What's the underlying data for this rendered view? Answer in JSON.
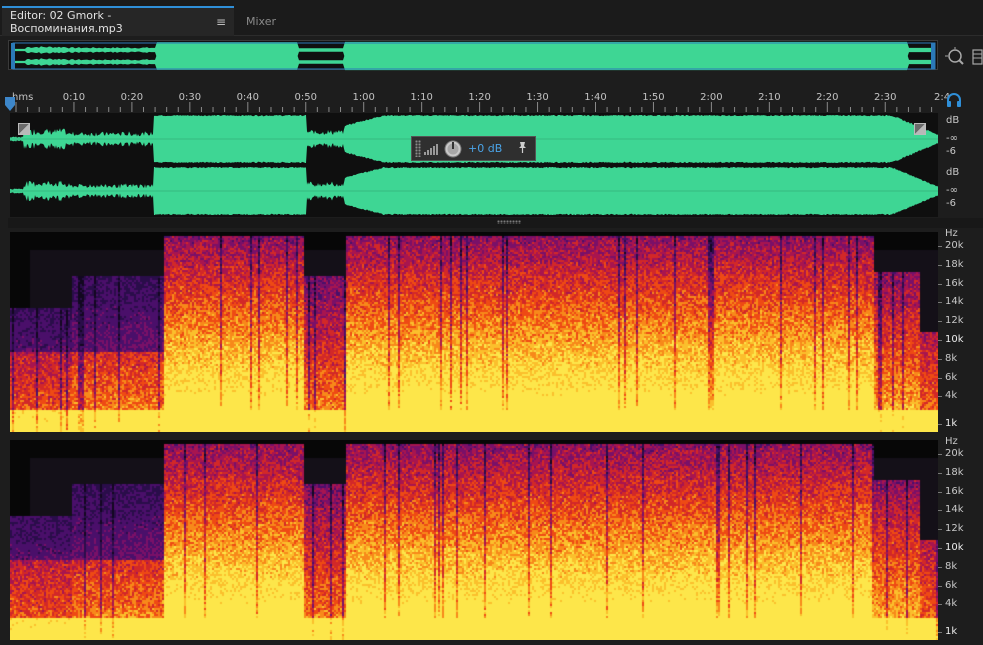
{
  "tabs": {
    "editor": {
      "label": "Editor: 02 Gmork - Воспоминания.mp3",
      "menu_glyph": "≡"
    },
    "mixer": {
      "label": "Mixer"
    }
  },
  "ruler": {
    "unit": "hms",
    "labels": [
      "0:10",
      "0:20",
      "0:30",
      "0:40",
      "0:50",
      "1:00",
      "1:10",
      "1:20",
      "1:30",
      "1:40",
      "1:50",
      "2:00",
      "2:10",
      "2:20",
      "2:30",
      "2:4"
    ]
  },
  "hud": {
    "value": "+0 dB",
    "pin_glyph": "✎"
  },
  "amplitude_scale": {
    "channel_1": [
      "dB",
      "-∞",
      "-6"
    ],
    "channel_2": [
      "dB",
      "-∞",
      "-6"
    ]
  },
  "frequency_scale": {
    "unit": "Hz",
    "labels": [
      "20k",
      "18k",
      "16k",
      "14k",
      "12k",
      "10k",
      "8k",
      "6k",
      "4k",
      "1k"
    ]
  },
  "colors": {
    "waveform": "#3ed694",
    "accent": "#2f8fd8",
    "hud_value": "#4aa3e6"
  },
  "icons": {
    "zoom": "zoom-icon",
    "headphones": "headphones-icon",
    "fade_in": "fade-in-handle-icon",
    "fade_out": "fade-out-handle-icon"
  }
}
